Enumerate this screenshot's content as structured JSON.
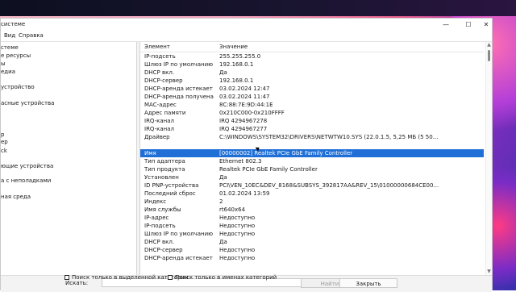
{
  "window": {
    "title": "системе",
    "min_icon": "—",
    "max_icon": "☐",
    "close_icon": "✕"
  },
  "menu": [
    "Вид",
    "Справка"
  ],
  "tree": [
    "стеме",
    "е ресурсы",
    "ы",
    "едиа",
    "устройство",
    "асные устройства",
    "р",
    "ер",
    "ck",
    "ющие устройства",
    "а с неполадками",
    "ная среда"
  ],
  "columns": {
    "element": "Элемент",
    "value": "Значение"
  },
  "rows": [
    [
      "IP-подсеть",
      "255.255.255.0"
    ],
    [
      "Шлюз IP по умолчанию",
      "192.168.0.1"
    ],
    [
      "DHCP вкл.",
      "Да"
    ],
    [
      "DHCP-сервер",
      "192.168.0.1"
    ],
    [
      "DHCP-аренда истекает",
      "03.02.2024 12:47"
    ],
    [
      "DHCP-аренда получена",
      "03.02.2024 11:47"
    ],
    [
      "MAC-адрес",
      "8C:88:7E:9D:44:1E"
    ],
    [
      "Адрес памяти",
      "0x210C000-0x210FFFF"
    ],
    [
      "IRQ-канал",
      "IRQ 4294967278"
    ],
    [
      "IRQ-канал",
      "IRQ 4294967277"
    ],
    [
      "Драйвер",
      "C:\\WINDOWS\\SYSTEM32\\DRIVERS\\NETWTW10.SYS (22.0.1.5, 5,25 МБ (5 50..."
    ],
    [
      "",
      ""
    ],
    [
      "Имя",
      "[00000002] Realtek PCIe GbE Family Controller"
    ],
    [
      "Тип адаптера",
      "Ethernet 802.3"
    ],
    [
      "Тип продукта",
      "Realtek PCIe GbE Family Controller"
    ],
    [
      "Установлен",
      "Да"
    ],
    [
      "ID PNP-устройства",
      "PCI\\VEN_10EC&DEV_8168&SUBSYS_392817AA&REV_15\\01000000684CE00..."
    ],
    [
      "Последний сброс",
      "01.02.2024 13:59"
    ],
    [
      "Индекс",
      "2"
    ],
    [
      "Имя службы",
      "rt640x64"
    ],
    [
      "IP-адрес",
      "Недоступно"
    ],
    [
      "IP-подсеть",
      "Недоступно"
    ],
    [
      "Шлюз IP по умолчанию",
      "Недоступно"
    ],
    [
      "DHCP вкл.",
      "Да"
    ],
    [
      "DHCP-сервер",
      "Недоступно"
    ],
    [
      "DHCP-аренда истекает",
      "Недоступно"
    ]
  ],
  "selected_row_index": 12,
  "footer": {
    "search_label": "Искать:",
    "search_value": "",
    "find_button": "Найти",
    "close_button": "Закрыть",
    "option1": "Поиск только в выделенной категории",
    "option2": "Поиск только в именах категорий"
  }
}
